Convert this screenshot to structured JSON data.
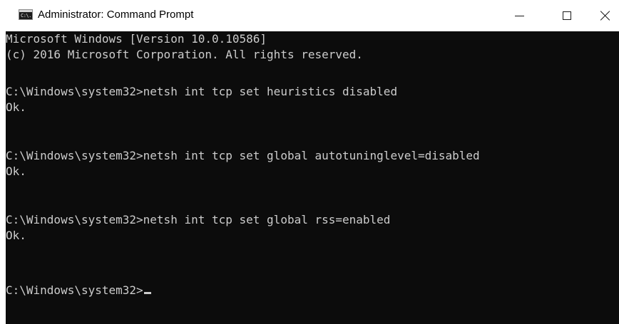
{
  "window": {
    "title": "Administrator: Command Prompt",
    "icon": "command-prompt-icon",
    "icon_text": "C:\\.",
    "controls": {
      "minimize": "minimize-icon",
      "maximize": "maximize-icon",
      "close": "close-icon"
    }
  },
  "console": {
    "background_color": "#0c0c0c",
    "text_color": "#cccccc",
    "lines": [
      "Microsoft Windows [Version 10.0.10586]",
      "(c) 2016 Microsoft Corporation. All rights reserved.",
      "C:\\Windows\\system32>netsh int tcp set heuristics disabled",
      "Ok.",
      "C:\\Windows\\system32>netsh int tcp set global autotuninglevel=disabled",
      "Ok.",
      "C:\\Windows\\system32>netsh int tcp set global rss=enabled",
      "Ok."
    ],
    "prompt": "C:\\Windows\\system32>"
  }
}
